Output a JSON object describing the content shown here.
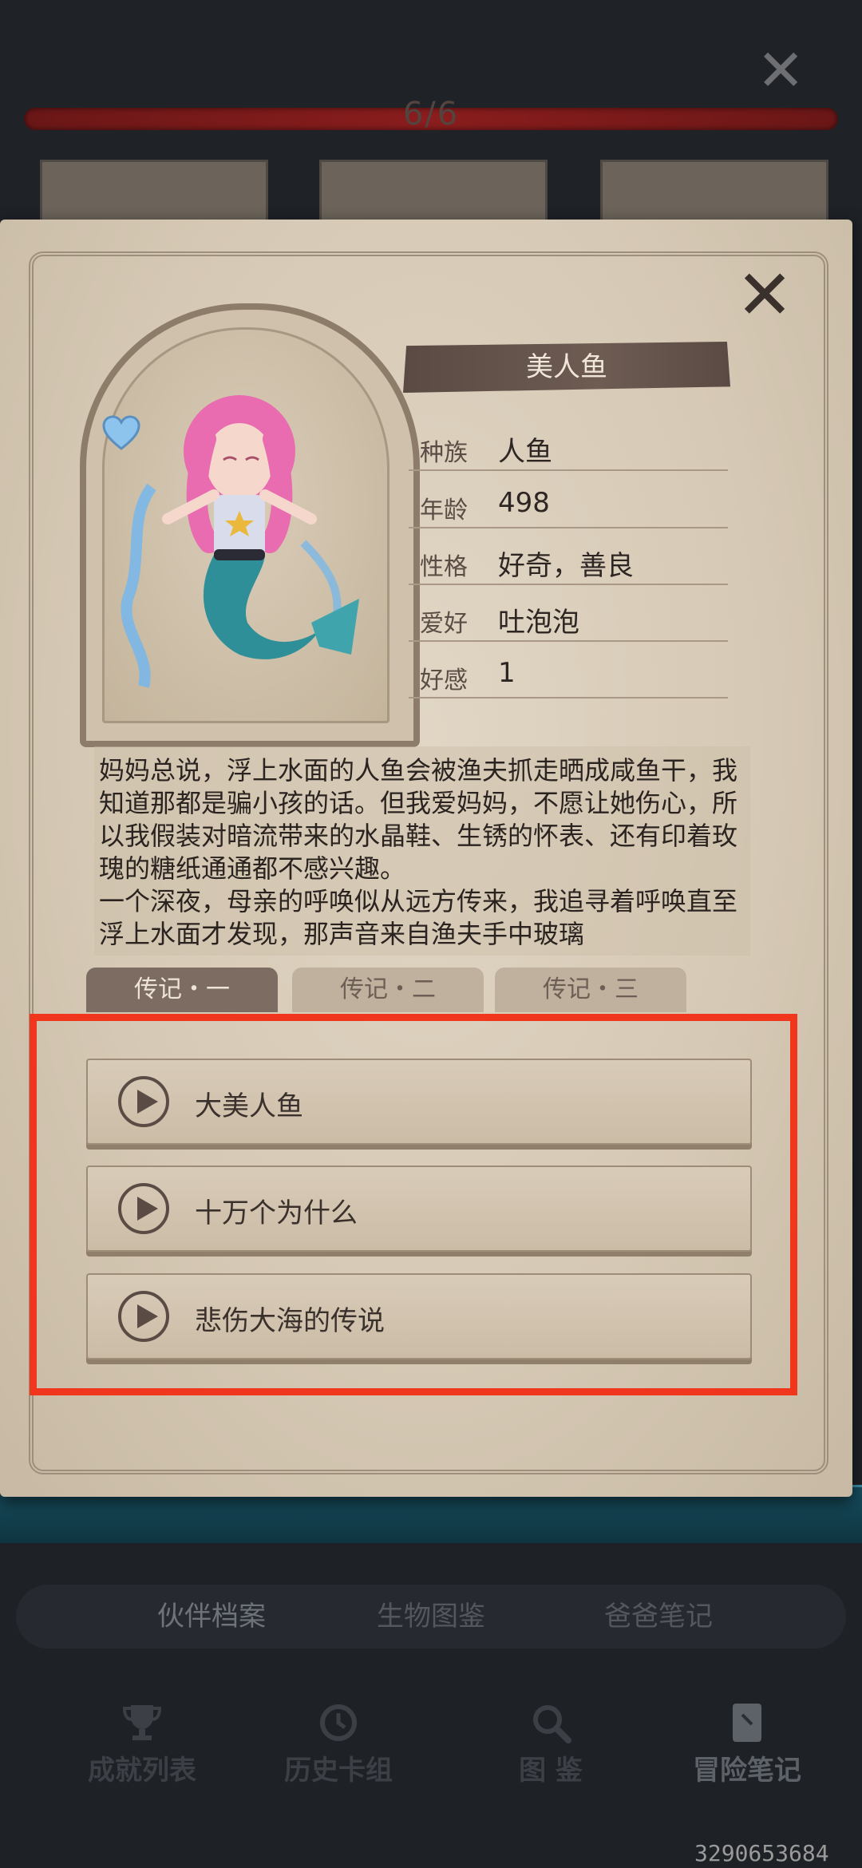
{
  "header": {
    "progress_text": "6/6",
    "progress_value": 1.0
  },
  "profile": {
    "name": "美人鱼",
    "rows": [
      {
        "label": "种族",
        "value": "人鱼"
      },
      {
        "label": "年龄",
        "value": "498"
      },
      {
        "label": "性格",
        "value": "好奇，善良"
      },
      {
        "label": "爱好",
        "value": "吐泡泡"
      },
      {
        "label": "好感",
        "value": "1"
      }
    ]
  },
  "story": {
    "text": "妈妈总说，浮上水面的人鱼会被渔夫抓走晒成咸鱼干，我知道那都是骗小孩的话。但我爱妈妈，不愿让她伤心，所以我假装对暗流带来的水晶鞋、生锈的怀表、还有印着玫瑰的糖纸通通都不感兴趣。\n一个深夜，母亲的呼唤似从远方传来，我追寻着呼唤直至浮上水面才发现，那声音来自渔夫手中玻璃"
  },
  "tabs": [
    "传记・一",
    "传记・二",
    "传记・三"
  ],
  "chapters": [
    "大美人鱼",
    "十万个为什么",
    "悲伤大海的传说"
  ],
  "subnav": [
    "伙伴档案",
    "生物图鉴",
    "爸爸笔记"
  ],
  "bottom_nav": [
    "成就列表",
    "历史卡组",
    "图 鉴",
    "冒险笔记"
  ],
  "watermark": "3290653684",
  "colors": {
    "highlight": "#f0371d",
    "banner": "#5a4a43",
    "page": "#d6c9b5"
  },
  "icons": {
    "close": "close-icon",
    "play": "play-icon",
    "trophy": "trophy-icon",
    "history": "history-icon",
    "magnifier": "magnifier-icon",
    "notebook": "notebook-icon"
  }
}
